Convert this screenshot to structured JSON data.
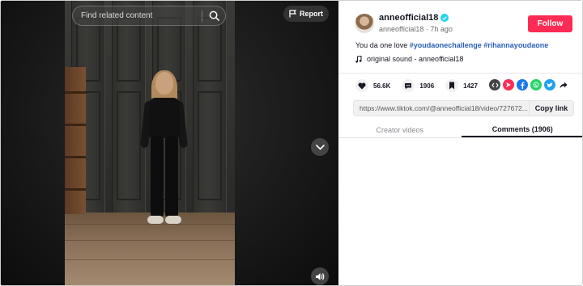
{
  "video": {
    "search_placeholder": "Find related content",
    "report_label": "Report"
  },
  "author": {
    "username": "anneofficial18",
    "handle": "anneofficial18",
    "posted": "7h ago",
    "follow_label": "Follow"
  },
  "caption": {
    "text": "You da one love",
    "hashtags": [
      "#youdaonechallenge",
      "#rihannayoudaone"
    ]
  },
  "sound": {
    "label": "original sound - anneofficial18"
  },
  "stats": {
    "likes": "56.6K",
    "comments": "1906",
    "saves": "1427"
  },
  "share_icons": [
    "embed-icon",
    "send-icon",
    "facebook-icon",
    "whatsapp-icon",
    "twitter-icon",
    "share-arrow-icon"
  ],
  "link": {
    "url": "https://www.tiktok.com/@anneofficial18/video/727672...",
    "copy_label": "Copy link"
  },
  "tabs": [
    {
      "label": "Creator videos"
    },
    {
      "label": "Comments (1906)"
    }
  ],
  "colors": {
    "accent": "#fe2c55",
    "hashtag": "#2b5db9",
    "verified": "#20d5ec"
  }
}
